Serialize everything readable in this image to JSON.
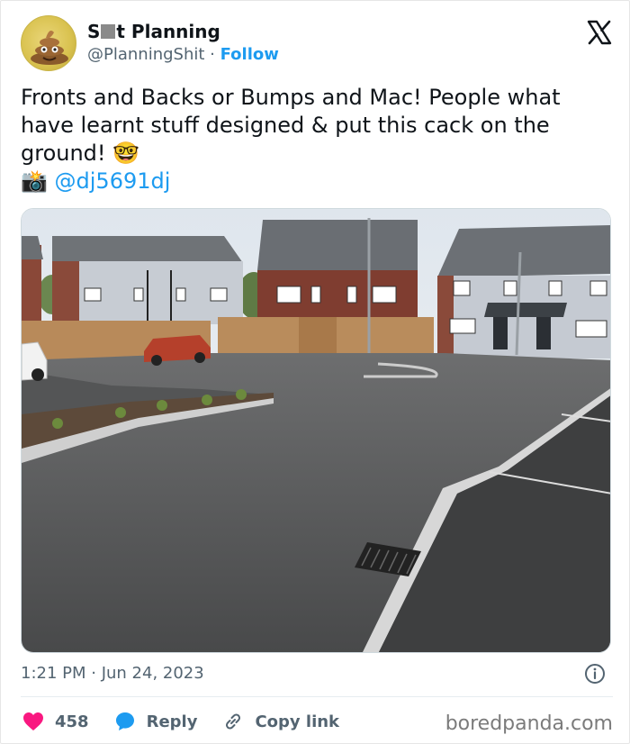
{
  "account": {
    "name_prefix": "S",
    "name_suffix": "t Planning",
    "handle": "@PlanningShit",
    "separator": " · ",
    "follow_label": "Follow"
  },
  "tweet": {
    "line1": "Fronts and Backs or Bumps and Mac! People what have learnt stuff designed & put this cack on the ground! 🤓",
    "camera_emoji": "📸",
    "credit": "@dj5691dj"
  },
  "meta": {
    "time": "1:21 PM",
    "separator": " · ",
    "date": "Jun 24, 2023"
  },
  "actions": {
    "likes": "458",
    "reply_label": "Reply",
    "copy_link_label": "Copy link"
  },
  "watermark": "boredpanda.com",
  "icons": {
    "avatar": "poop-emoji-avatar",
    "x_logo": "x-logo-icon",
    "info": "info-icon",
    "like": "heart-icon",
    "reply": "speech-bubble-icon",
    "link": "link-icon"
  },
  "colors": {
    "link_blue": "#1d9bf0",
    "like_pink": "#f91880",
    "secondary_text": "#536471"
  }
}
